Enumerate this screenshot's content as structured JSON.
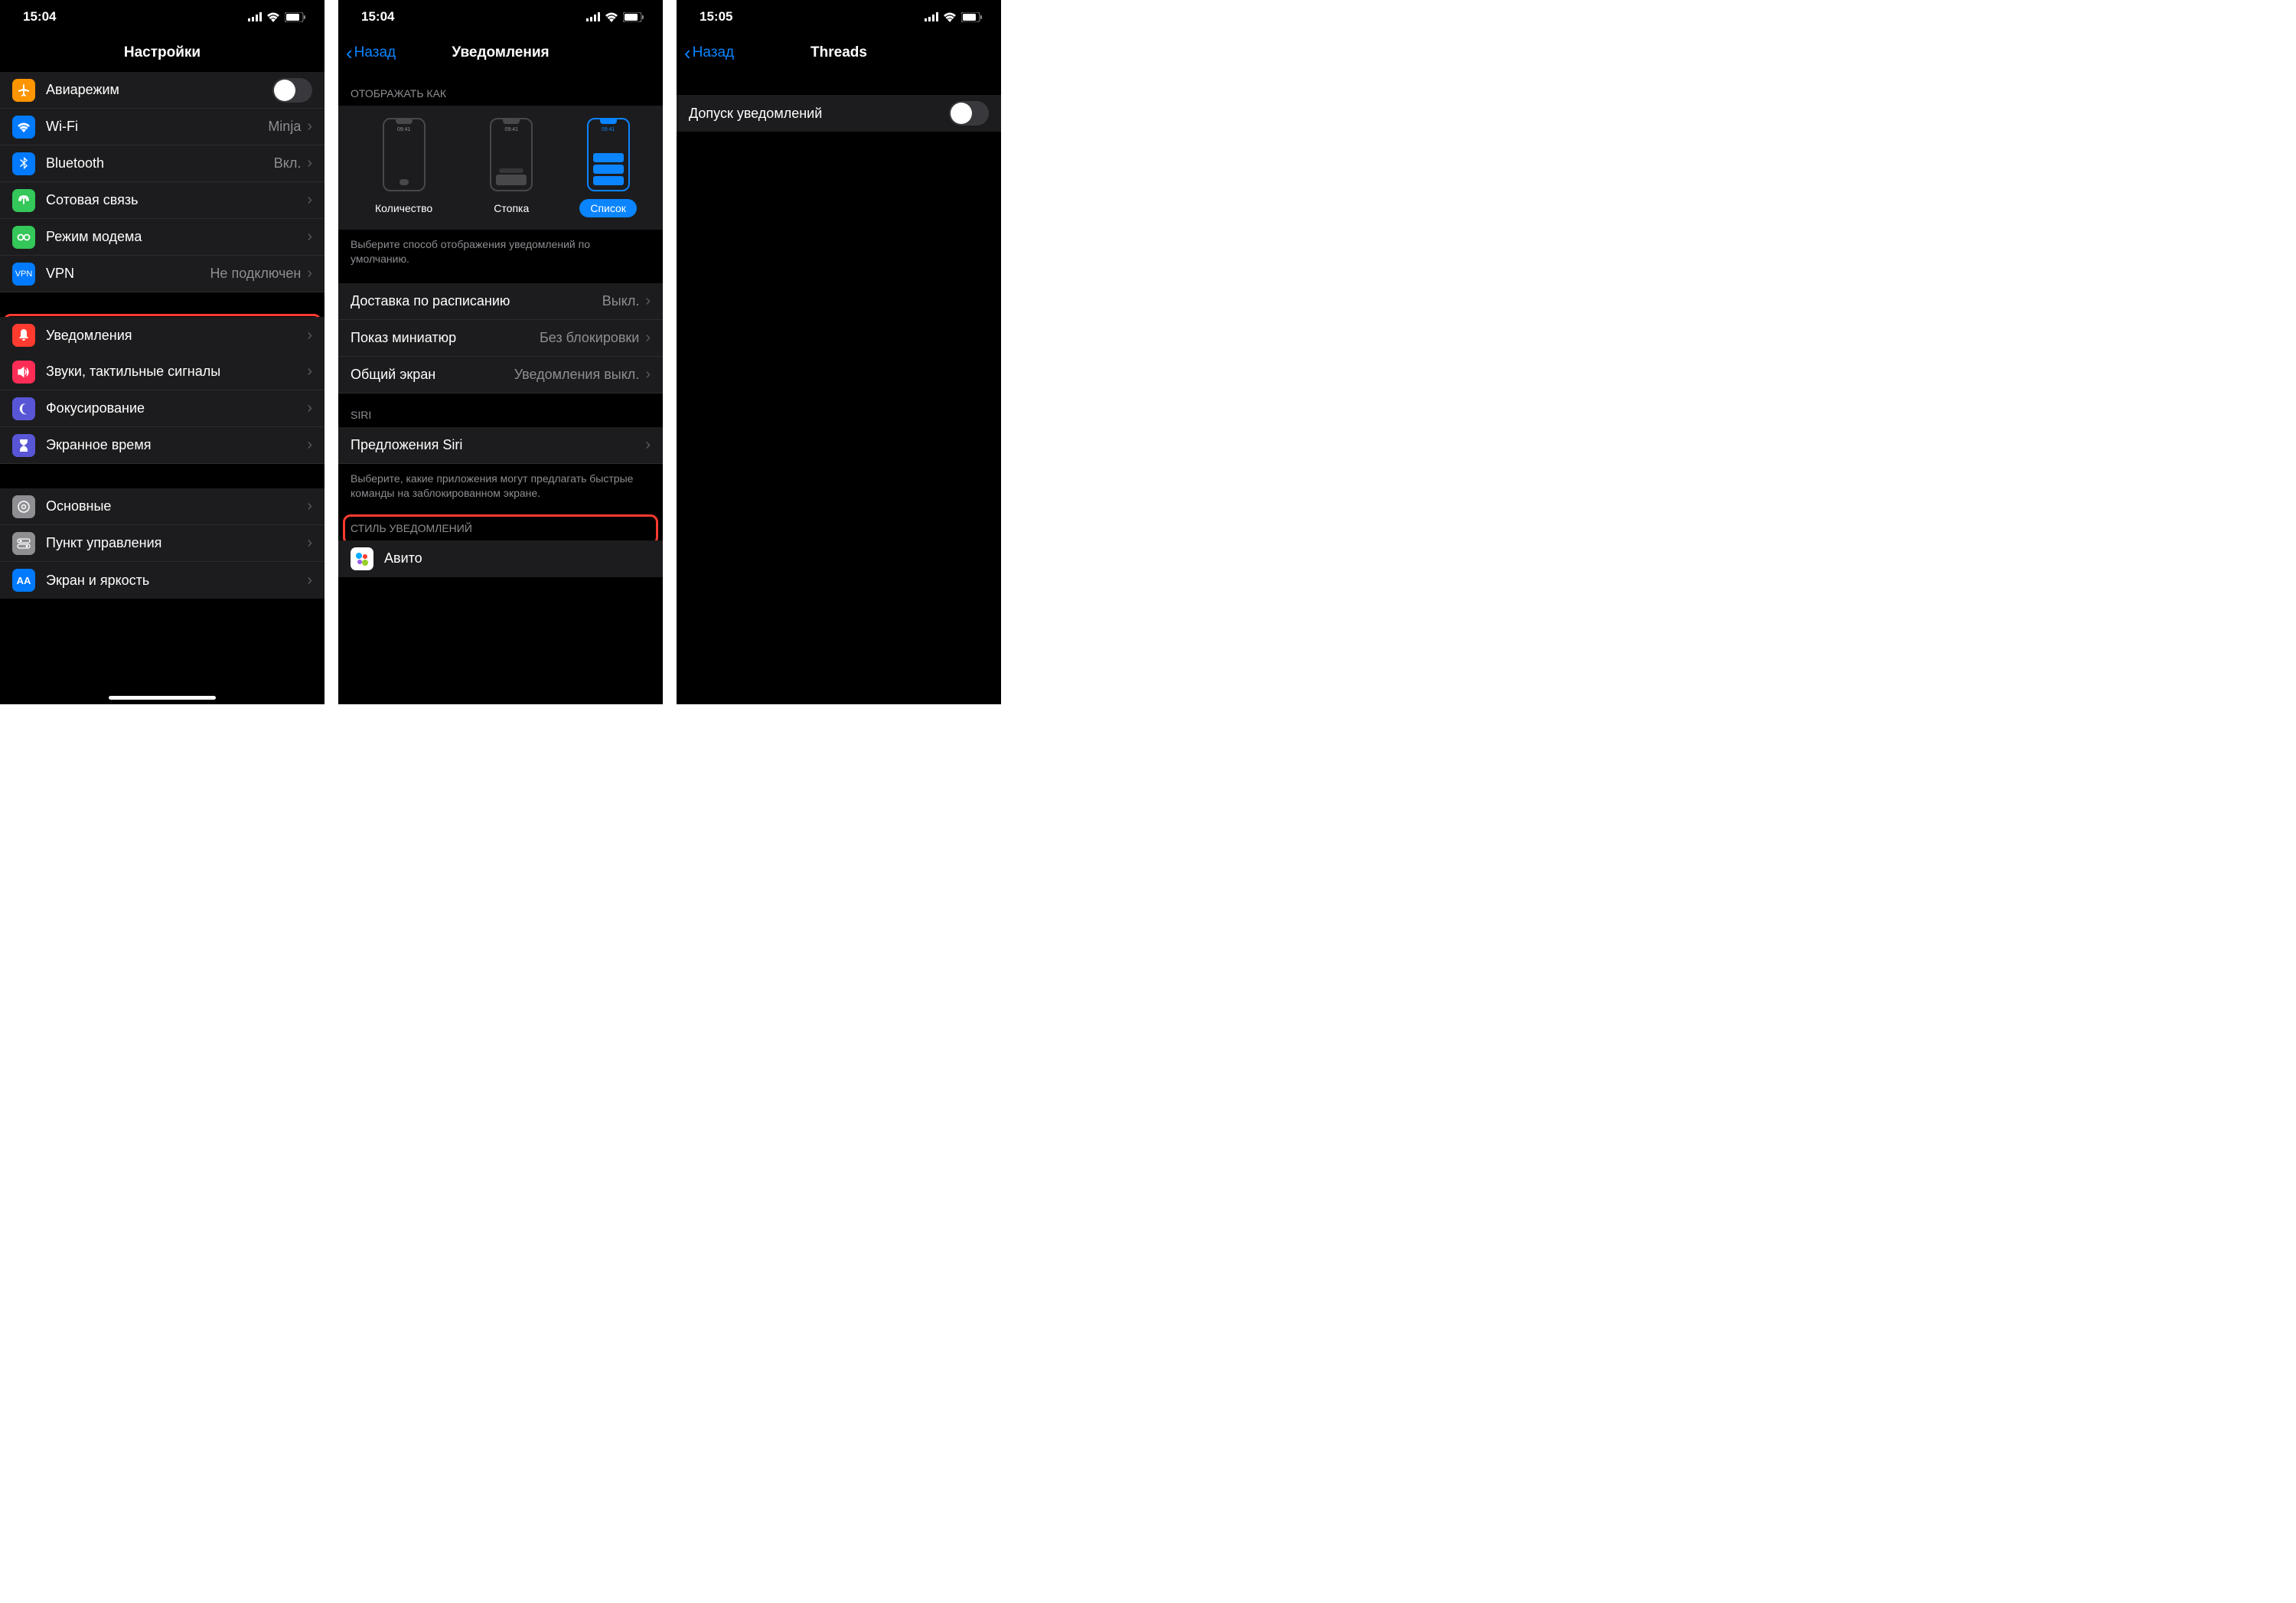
{
  "status": {
    "time1": "15:04",
    "time2": "15:04",
    "time3": "15:05"
  },
  "nav": {
    "back": "Назад",
    "title1": "Настройки",
    "title2": "Уведомления",
    "title3": "Threads"
  },
  "s1": {
    "airplane": "Авиарежим",
    "wifi": "Wi-Fi",
    "wifi_val": "Minja",
    "bt": "Bluetooth",
    "bt_val": "Вкл.",
    "cellular": "Сотовая связь",
    "hotspot": "Режим модема",
    "vpn": "VPN",
    "vpn_val": "Не подключен",
    "notifications": "Уведомления",
    "sounds": "Звуки, тактильные сигналы",
    "focus": "Фокусирование",
    "screentime": "Экранное время",
    "general": "Основные",
    "control": "Пункт управления",
    "display": "Экран и яркость"
  },
  "s2": {
    "display_as": "ОТОБРАЖАТЬ КАК",
    "opt_count": "Количество",
    "opt_stack": "Стопка",
    "opt_list": "Список",
    "opt_time": "09:41",
    "display_footer": "Выберите способ отображения уведомлений по умолчанию.",
    "scheduled": "Доставка по расписанию",
    "scheduled_val": "Выкл.",
    "previews": "Показ миниатюр",
    "previews_val": "Без блокировки",
    "shared": "Общий экран",
    "shared_val": "Уведомления выкл.",
    "siri_hdr": "SIRI",
    "siri_suggestions": "Предложения Siri",
    "siri_footer": "Выберите, какие приложения могут предлагать быстрые команды на заблокированном экране.",
    "style_hdr": "СТИЛЬ УВЕДОМЛЕНИЙ",
    "avito": "Авито"
  },
  "s3": {
    "allow": "Допуск уведомлений"
  }
}
